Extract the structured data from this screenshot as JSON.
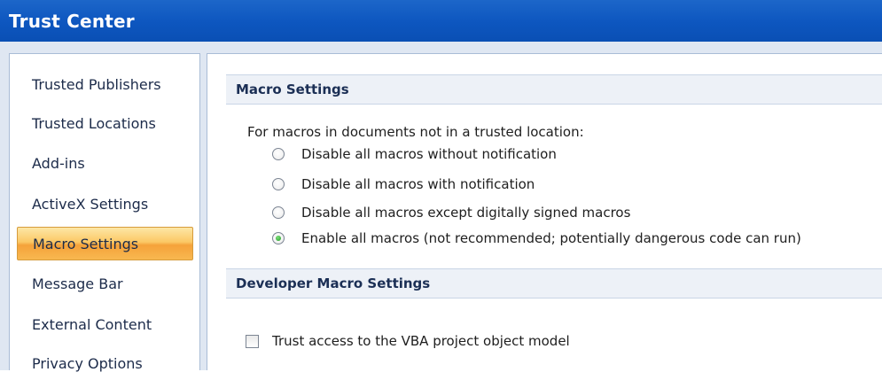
{
  "window": {
    "title": "Trust Center"
  },
  "sidebar": {
    "items": [
      {
        "label": "Trusted Publishers",
        "selected": false
      },
      {
        "label": "Trusted Locations",
        "selected": false
      },
      {
        "label": "Add-ins",
        "selected": false
      },
      {
        "label": "ActiveX Settings",
        "selected": false
      },
      {
        "label": "Macro Settings",
        "selected": true
      },
      {
        "label": "Message Bar",
        "selected": false
      },
      {
        "label": "External Content",
        "selected": false
      },
      {
        "label": "Privacy Options",
        "selected": false
      }
    ]
  },
  "macro_settings": {
    "header": "Macro Settings",
    "description": "For macros in documents not in a trusted location:",
    "options": [
      {
        "label": "Disable all macros without notification",
        "checked": false
      },
      {
        "label": "Disable all macros with notification",
        "checked": false
      },
      {
        "label": "Disable all macros except digitally signed macros",
        "checked": false
      },
      {
        "label": "Enable all macros (not recommended; potentially dangerous code can run)",
        "checked": true
      }
    ]
  },
  "developer_settings": {
    "header": "Developer Macro Settings",
    "trust_vba": {
      "label": "Trust access to the VBA project object model",
      "checked": false
    }
  },
  "colors": {
    "title_bar": "#0d56bf",
    "selected_item": "#fbc865",
    "section_header_text": "#1b2f55",
    "radio_selected_dot": "#1f9a27"
  }
}
